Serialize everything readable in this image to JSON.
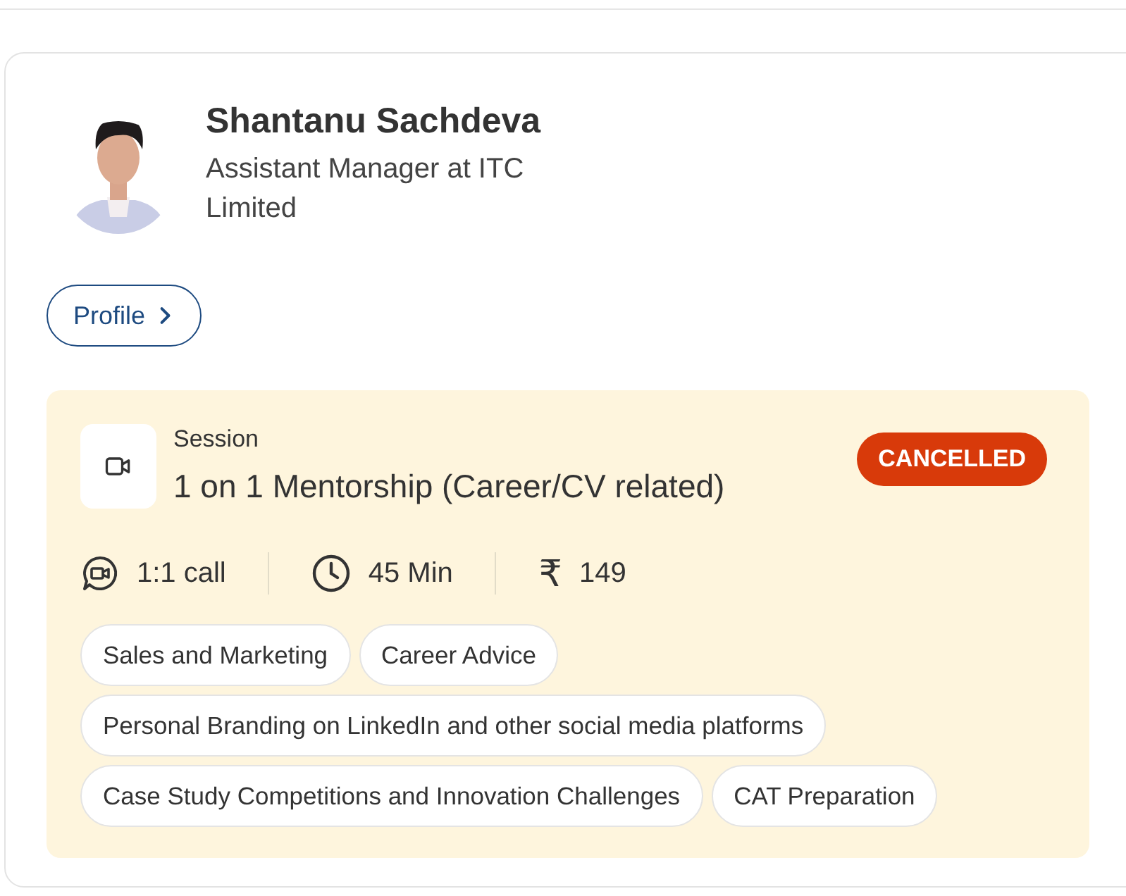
{
  "mentor": {
    "name": "Shantanu Sachdeva",
    "headline": "Assistant Manager at ITC Limited"
  },
  "profile_button": {
    "label": "Profile"
  },
  "session": {
    "label": "Session",
    "title": "1 on 1 Mentorship (Career/CV related)",
    "status": {
      "label": "CANCELLED",
      "kind": "cancelled"
    },
    "meta": [
      {
        "kind": "call",
        "text": "1:1 call"
      },
      {
        "kind": "duration",
        "text": "45 Min"
      },
      {
        "kind": "price",
        "text": "₹",
        "value": "149"
      }
    ],
    "tags": [
      "Sales and Marketing",
      "Career Advice",
      "Personal Branding on LinkedIn and other social media platforms",
      "Case Study Competitions and Innovation Challenges",
      "CAT Preparation"
    ]
  }
}
